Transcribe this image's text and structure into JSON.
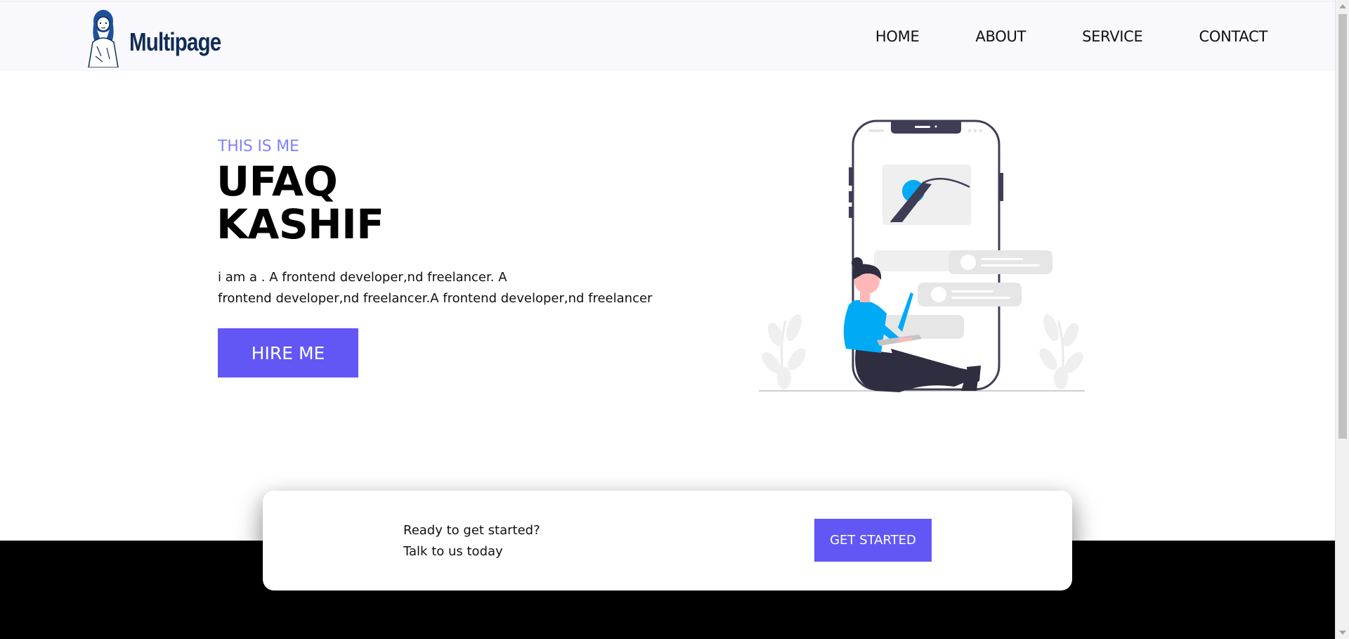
{
  "navbar": {
    "brand": "Multipage",
    "links": [
      {
        "label": "HOME"
      },
      {
        "label": "ABOUT"
      },
      {
        "label": "SERVICE"
      },
      {
        "label": "CONTACT"
      }
    ]
  },
  "hero": {
    "eyebrow": "THIS IS ME",
    "name_line1": "UFAQ",
    "name_line2": "KASHIF",
    "desc_line1": "i am a . A frontend developer,nd freelancer. A",
    "desc_line2": "frontend developer,nd freelancer.A frontend developer,nd freelancer",
    "hire_button": "HIRE ME"
  },
  "cta": {
    "line1": "Ready to get started?",
    "line2": "Talk to us today",
    "button": "GET STARTED"
  },
  "colors": {
    "accent": "#6257f5",
    "eyebrow": "#8083f5",
    "brand": "#0f2d55",
    "illustration_blue": "#00aaf5"
  }
}
